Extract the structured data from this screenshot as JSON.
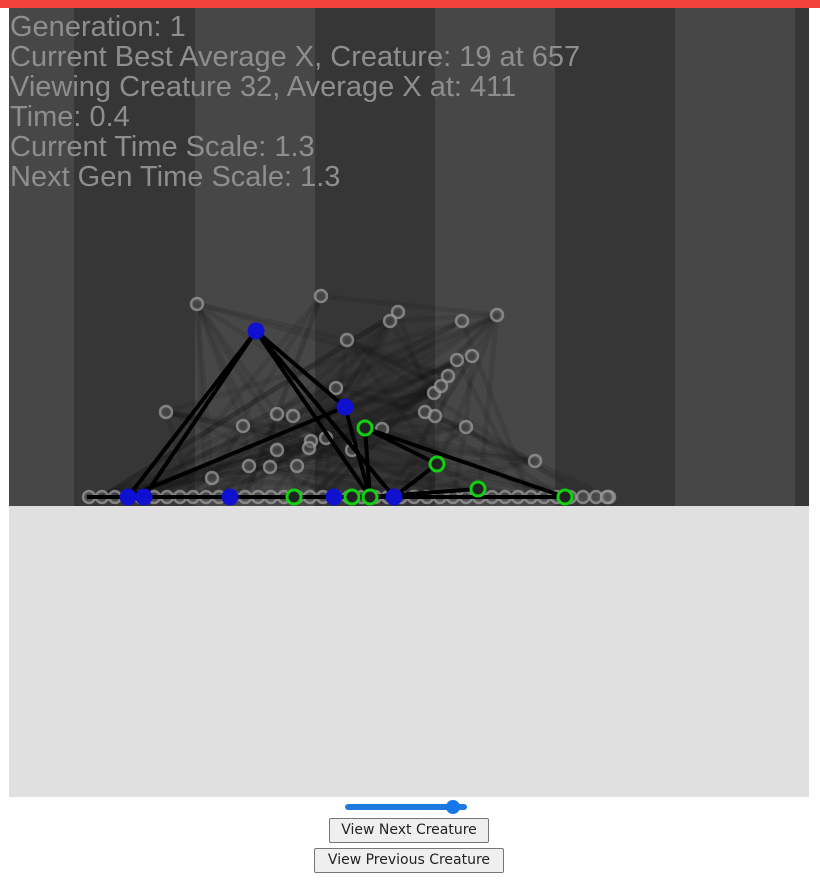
{
  "hud": {
    "generation": "Generation: 1",
    "best": "Current Best Average X, Creature: 19 at 657",
    "viewing": "Viewing Creature 32, Average X at: 411",
    "time": "Time: 0.4",
    "time_scale": "Current Time Scale: 1.3",
    "next_time_scale": "Next Gen Time Scale: 1.3"
  },
  "slider": {
    "value": 0.9
  },
  "buttons": {
    "next": "View Next Creature",
    "prev": "View Previous Creature"
  },
  "colors": {
    "accent_bar": "#f2403a",
    "ground": "#e0e0e0",
    "stripe_dark": "#363636",
    "stripe_light": "#474747",
    "node_blue": "#1010d0",
    "node_green": "#10d010",
    "ghost": "#a0a0a0"
  }
}
